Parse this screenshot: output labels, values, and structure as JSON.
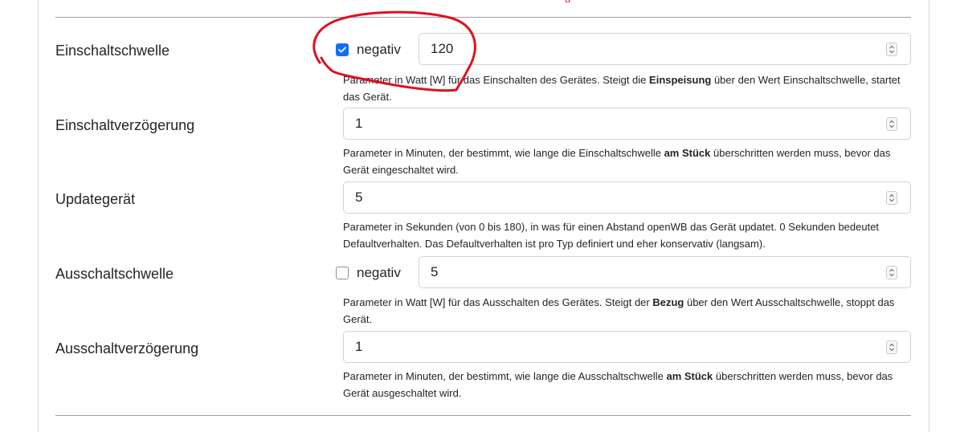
{
  "top_fragment": "g",
  "rows": [
    {
      "label": "Einschaltschwelle",
      "negative_checkbox": {
        "label": "negativ",
        "checked": true
      },
      "value": "120",
      "help": {
        "pre": "Parameter in Watt [W] für das Einschalten des Gerätes. Steigt die ",
        "bold": "Einspeisung",
        "post": " über den Wert Einschaltschwelle, startet das Gerät."
      }
    },
    {
      "label": "Einschaltverzögerung",
      "value": "1",
      "help": {
        "pre": "Parameter in Minuten, der bestimmt, wie lange die Einschaltschwelle ",
        "bold": "am Stück",
        "post": " überschritten werden muss, bevor das Gerät eingeschaltet wird."
      }
    },
    {
      "label": "Updategerät",
      "value": "5",
      "help": {
        "pre": "Parameter in Sekunden (von 0 bis 180), in was für einen Abstand openWB das Gerät updatet. 0 Sekunden bedeutet Defaultverhalten. Das Defaultverhalten ist pro Typ definiert und eher konservativ (langsam).",
        "bold": "",
        "post": ""
      }
    },
    {
      "label": "Ausschaltschwelle",
      "negative_checkbox": {
        "label": "negativ",
        "checked": false
      },
      "value": "5",
      "help": {
        "pre": "Parameter in Watt [W] für das Ausschalten des Gerätes. Steigt der ",
        "bold": "Bezug",
        "post": " über den Wert Ausschaltschwelle, stoppt das Gerät."
      }
    },
    {
      "label": "Ausschaltverzögerung",
      "value": "1",
      "help": {
        "pre": "Parameter in Minuten, der bestimmt, wie lange die Ausschaltschwelle ",
        "bold": "am Stück",
        "post": " überschritten werden muss, bevor das Gerät ausgeschaltet wird."
      }
    }
  ],
  "colors": {
    "checkbox_checked": "#0d6efd",
    "annotation": "#e0101e",
    "border": "#ced4da"
  },
  "icons": {
    "checkbox_checked": "checkmark-icon",
    "spinner": "up-down-chevron-icon"
  }
}
